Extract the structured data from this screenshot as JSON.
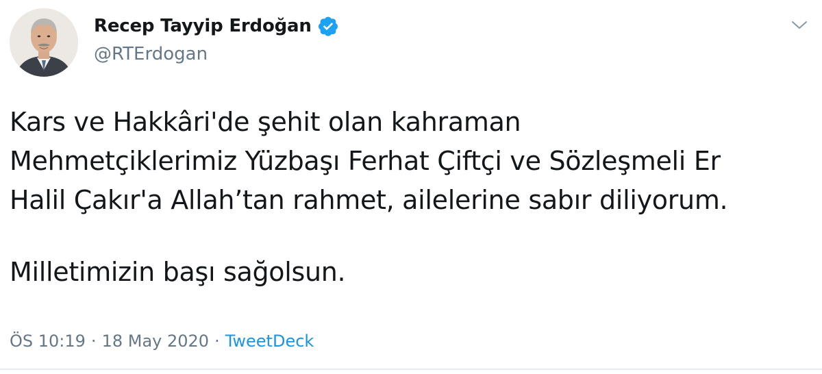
{
  "author": {
    "display_name": "Recep Tayyip Erdoğan",
    "handle": "@RTErdogan",
    "verified": true,
    "verified_color": "#1da1f2"
  },
  "tweet": {
    "lines": [
      "Kars ve Hakkâri'de şehit olan kahraman",
      "Mehmetçiklerimiz Yüzbaşı Ferhat Çiftçi ve Sözleşmeli Er",
      "Halil Çakır'a Allah’tan rahmet, ailelerine sabır diliyorum."
    ],
    "closing": "Milletimizin başı sağolsun."
  },
  "meta": {
    "time": "ÖS 10:19",
    "separator_1": "·",
    "date": "18 May 2020",
    "separator_2": "·",
    "source": "TweetDeck"
  },
  "icons": {
    "verified": "verified-badge-icon",
    "menu": "chevron-down-icon"
  },
  "colors": {
    "text": "#14171a",
    "secondary": "#657786",
    "link": "#1b95e0"
  }
}
